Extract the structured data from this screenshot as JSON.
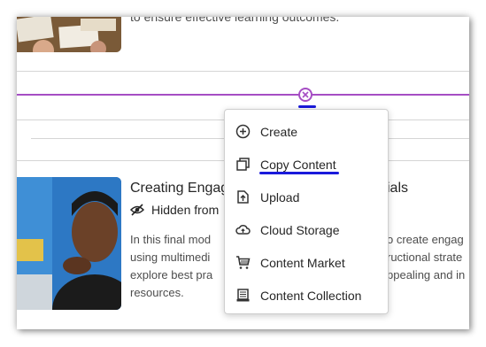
{
  "top_item": {
    "description": "to ensure effective learning outcomes."
  },
  "bottom_item": {
    "title_start": "Creating Engag",
    "title_end": "ials",
    "visibility": "Hidden from",
    "description_lines": [
      {
        "left": "In this final mod",
        "right": "o create engag"
      },
      {
        "left": "using multimedi",
        "right": "ructional strate"
      },
      {
        "left": "explore best pra",
        "right": "ppealing and in"
      },
      {
        "left": "resources.",
        "right": ""
      }
    ]
  },
  "menu": {
    "items": [
      {
        "label": "Create",
        "icon": "plus-circle-icon"
      },
      {
        "label": "Copy Content",
        "icon": "copy-icon"
      },
      {
        "label": "Upload",
        "icon": "upload-icon"
      },
      {
        "label": "Cloud Storage",
        "icon": "cloud-upload-icon"
      },
      {
        "label": "Content Market",
        "icon": "cart-icon"
      },
      {
        "label": "Content Collection",
        "icon": "content-collection-icon"
      }
    ]
  },
  "colors": {
    "insert_line": "#a64ec4",
    "annotation": "#1a1adb"
  }
}
